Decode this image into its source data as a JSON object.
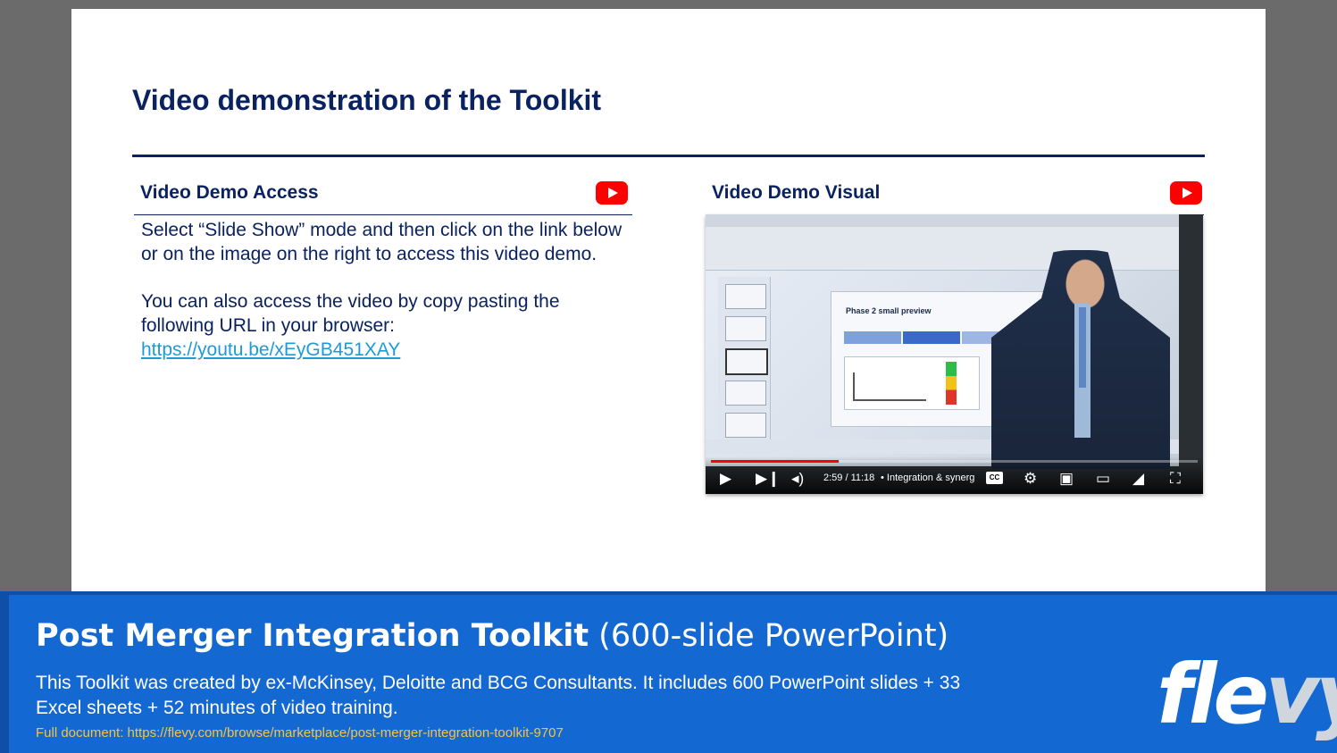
{
  "slide": {
    "title": "Video demonstration of the Toolkit",
    "left_panel": {
      "heading": "Video Demo Access",
      "paragraph1": "Select “Slide Show” mode and then click on the link below or on the image on the right to access this video demo.",
      "paragraph2": "You can also access the video by copy pasting the following URL in your browser:",
      "url": "https://youtu.be/xEyGB451XAY",
      "icon": "youtube-icon"
    },
    "right_panel": {
      "heading": "Video Demo Visual",
      "icon": "youtube-icon"
    },
    "video": {
      "slide_title_on_screen": "Phase 2 small preview",
      "time": "2:59 / 11:18",
      "chapter": "• Integration & synerg",
      "progress": 0.263,
      "cc_label": "CC"
    }
  },
  "footer": {
    "title_bold": "Post Merger Integration Toolkit",
    "title_rest": " (600-slide PowerPoint)",
    "description": "This Toolkit was created by ex-McKinsey, Deloitte and BCG Consultants. It includes 600 PowerPoint slides + 33 Excel sheets + 52 minutes of video training.",
    "link": "Full document: https://flevy.com/browse/marketplace/post-merger-integration-toolkit-9707",
    "logo": "flevy"
  },
  "colors": {
    "navy": "#0b2260",
    "link": "#1e9ad6",
    "footer_blue": "#1468d1",
    "footer_link": "#f4c542",
    "youtube_red": "#ff0000"
  }
}
